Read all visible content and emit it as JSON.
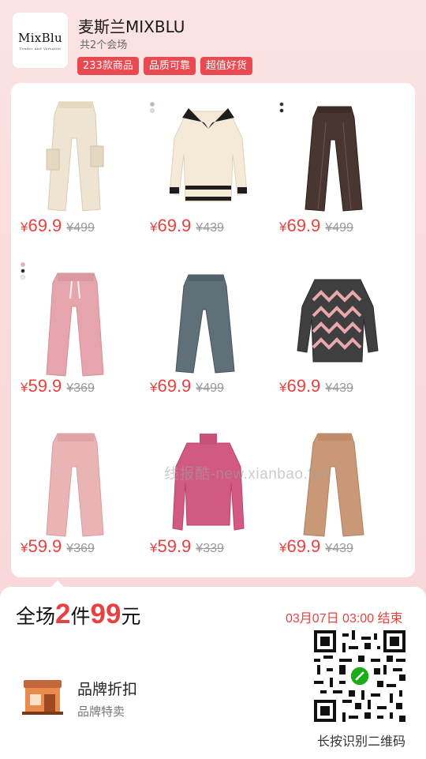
{
  "brand": {
    "logo_text": "MixBlu",
    "logo_tagline": "Tender And Versatile",
    "name": "麦斯兰MIXBLU",
    "venues": "共2个会场",
    "tags": [
      "233款商品",
      "品质可靠",
      "超值好货"
    ]
  },
  "products": [
    {
      "name": "cream cargo pants",
      "price": "69.9",
      "original": "¥499",
      "swatches": []
    },
    {
      "name": "cream knit polo sweater",
      "price": "69.9",
      "original": "¥439",
      "swatches": [
        "#b8b89a",
        "#dedede"
      ]
    },
    {
      "name": "brown leather cargo pants",
      "price": "69.9",
      "original": "¥499",
      "swatches": [
        "#3a2a26",
        "#222222"
      ]
    },
    {
      "name": "pink corduroy pants",
      "price": "59.9",
      "original": "¥369",
      "swatches": [
        "#e9a9b3",
        "#222222",
        "#eeeeee"
      ]
    },
    {
      "name": "denim jeans",
      "price": "69.9",
      "original": "¥499",
      "swatches": []
    },
    {
      "name": "pink striped knit sweater",
      "price": "69.9",
      "original": "¥439",
      "swatches": []
    },
    {
      "name": "pink wide-leg pants",
      "price": "59.9",
      "original": "¥369",
      "swatches": []
    },
    {
      "name": "pink ribbed turtleneck",
      "price": "59.9",
      "original": "¥339",
      "swatches": []
    },
    {
      "name": "camel wide-leg pants",
      "price": "69.9",
      "original": "¥439",
      "swatches": []
    }
  ],
  "currency": "¥",
  "watermark": "线报酷-new.xianbao.fun",
  "promo": {
    "part1": "全场",
    "count": "2",
    "part2": "件",
    "price": "99",
    "part3": "元"
  },
  "deadline": "03月07日 03:00 结束",
  "discount": {
    "title": "品牌折扣",
    "subtitle": "品牌特卖"
  },
  "qr_label": "长按识别二维码",
  "colors": {
    "accent": "#e8413f",
    "tag_bg": "#e94a51",
    "background": "#f9dcde"
  }
}
